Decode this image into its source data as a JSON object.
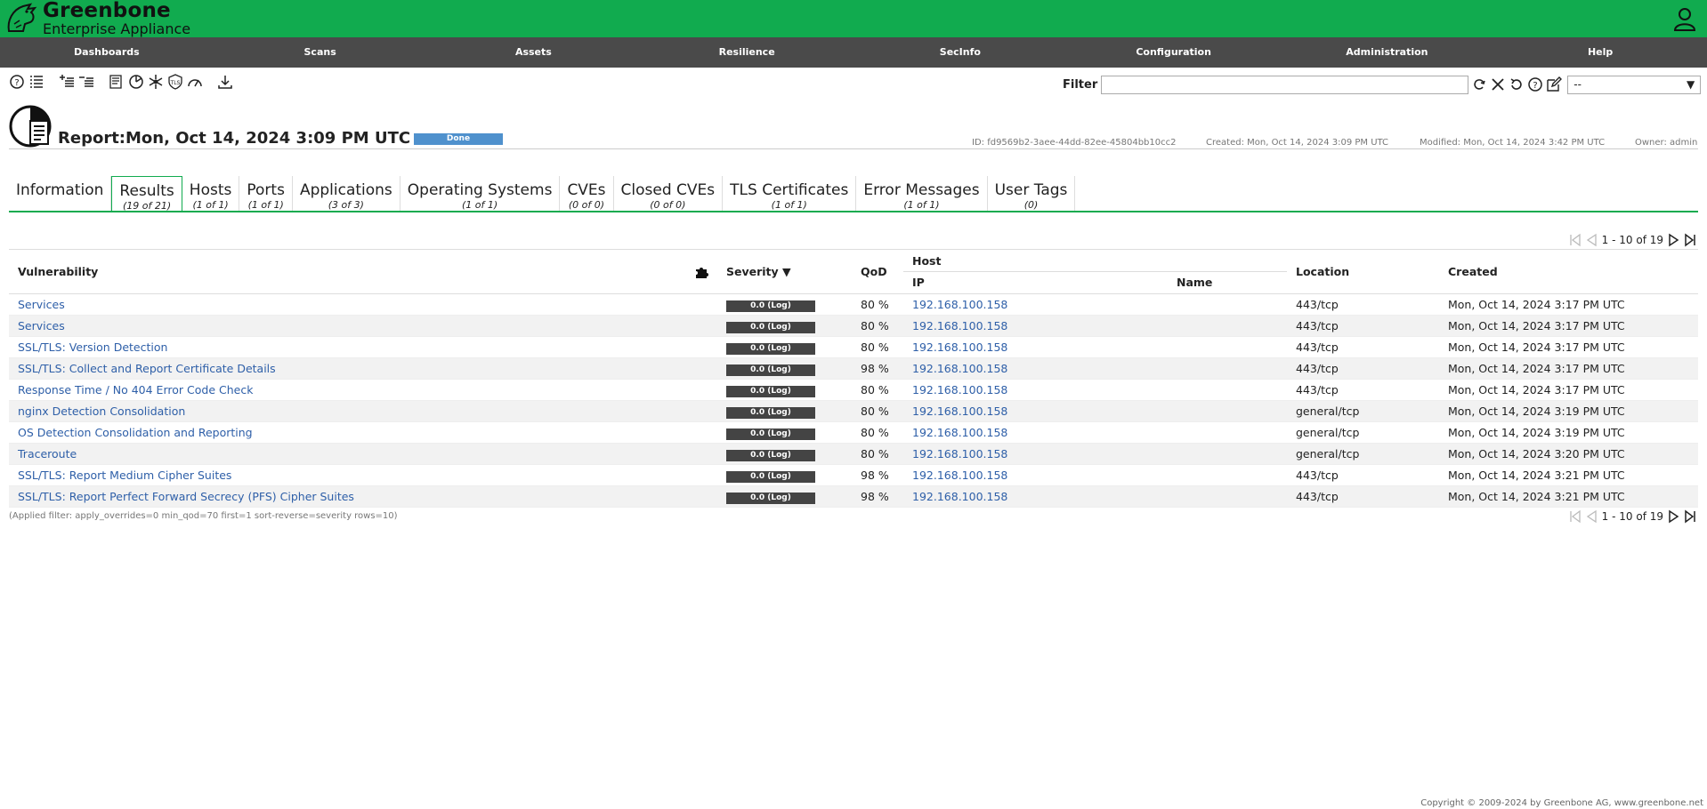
{
  "brand": {
    "name": "Greenbone",
    "subtitle": "Enterprise Appliance"
  },
  "nav": [
    "Dashboards",
    "Scans",
    "Assets",
    "Resilience",
    "SecInfo",
    "Configuration",
    "Administration",
    "Help"
  ],
  "filter": {
    "label": "Filter",
    "value": "",
    "select_value": "--"
  },
  "report": {
    "title": "Report:Mon, Oct 14, 2024 3:09 PM UTC",
    "status": "Done",
    "id": "ID: fd9569b2-3aee-44dd-82ee-45804bb10cc2",
    "created": "Created: Mon, Oct 14, 2024 3:09 PM UTC",
    "modified": "Modified: Mon, Oct 14, 2024 3:42 PM UTC",
    "owner": "Owner: admin"
  },
  "tabs": [
    {
      "label": "Information",
      "count": ""
    },
    {
      "label": "Results",
      "count": "(19 of 21)"
    },
    {
      "label": "Hosts",
      "count": "(1 of 1)"
    },
    {
      "label": "Ports",
      "count": "(1 of 1)"
    },
    {
      "label": "Applications",
      "count": "(3 of 3)"
    },
    {
      "label": "Operating Systems",
      "count": "(1 of 1)"
    },
    {
      "label": "CVEs",
      "count": "(0 of 0)"
    },
    {
      "label": "Closed CVEs",
      "count": "(0 of 0)"
    },
    {
      "label": "TLS Certificates",
      "count": "(1 of 1)"
    },
    {
      "label": "Error Messages",
      "count": "(1 of 1)"
    },
    {
      "label": "User Tags",
      "count": "(0)"
    }
  ],
  "pager": {
    "text": "1 - 10 of 19"
  },
  "table": {
    "headers": {
      "vulnerability": "Vulnerability",
      "severity": "Severity ▼",
      "qod": "QoD",
      "host": "Host",
      "ip": "IP",
      "name": "Name",
      "location": "Location",
      "created": "Created"
    },
    "rows": [
      {
        "vuln": "Services",
        "sev": "0.0 (Log)",
        "qod": "80 %",
        "ip": "192.168.100.158",
        "name": "",
        "loc": "443/tcp",
        "created": "Mon, Oct 14, 2024 3:17 PM UTC"
      },
      {
        "vuln": "Services",
        "sev": "0.0 (Log)",
        "qod": "80 %",
        "ip": "192.168.100.158",
        "name": "",
        "loc": "443/tcp",
        "created": "Mon, Oct 14, 2024 3:17 PM UTC"
      },
      {
        "vuln": "SSL/TLS: Version Detection",
        "sev": "0.0 (Log)",
        "qod": "80 %",
        "ip": "192.168.100.158",
        "name": "",
        "loc": "443/tcp",
        "created": "Mon, Oct 14, 2024 3:17 PM UTC"
      },
      {
        "vuln": "SSL/TLS: Collect and Report Certificate Details",
        "sev": "0.0 (Log)",
        "qod": "98 %",
        "ip": "192.168.100.158",
        "name": "",
        "loc": "443/tcp",
        "created": "Mon, Oct 14, 2024 3:17 PM UTC"
      },
      {
        "vuln": "Response Time / No 404 Error Code Check",
        "sev": "0.0 (Log)",
        "qod": "80 %",
        "ip": "192.168.100.158",
        "name": "",
        "loc": "443/tcp",
        "created": "Mon, Oct 14, 2024 3:17 PM UTC"
      },
      {
        "vuln": "nginx Detection Consolidation",
        "sev": "0.0 (Log)",
        "qod": "80 %",
        "ip": "192.168.100.158",
        "name": "",
        "loc": "general/tcp",
        "created": "Mon, Oct 14, 2024 3:19 PM UTC"
      },
      {
        "vuln": "OS Detection Consolidation and Reporting",
        "sev": "0.0 (Log)",
        "qod": "80 %",
        "ip": "192.168.100.158",
        "name": "",
        "loc": "general/tcp",
        "created": "Mon, Oct 14, 2024 3:19 PM UTC"
      },
      {
        "vuln": "Traceroute",
        "sev": "0.0 (Log)",
        "qod": "80 %",
        "ip": "192.168.100.158",
        "name": "",
        "loc": "general/tcp",
        "created": "Mon, Oct 14, 2024 3:20 PM UTC"
      },
      {
        "vuln": "SSL/TLS: Report Medium Cipher Suites",
        "sev": "0.0 (Log)",
        "qod": "98 %",
        "ip": "192.168.100.158",
        "name": "",
        "loc": "443/tcp",
        "created": "Mon, Oct 14, 2024 3:21 PM UTC"
      },
      {
        "vuln": "SSL/TLS: Report Perfect Forward Secrecy (PFS) Cipher Suites",
        "sev": "0.0 (Log)",
        "qod": "98 %",
        "ip": "192.168.100.158",
        "name": "",
        "loc": "443/tcp",
        "created": "Mon, Oct 14, 2024 3:21 PM UTC"
      }
    ]
  },
  "applied_filter": "(Applied filter: apply_overrides=0 min_qod=70 first=1 sort-reverse=severity rows=10)",
  "footer": "Copyright © 2009-2024 by Greenbone AG, www.greenbone.net",
  "colors": {
    "brand_green": "#11ab4f",
    "nav_bg": "#4a4a4a",
    "link": "#2e5fa8",
    "status_done": "#4f91cd",
    "severity_log": "#444444"
  }
}
